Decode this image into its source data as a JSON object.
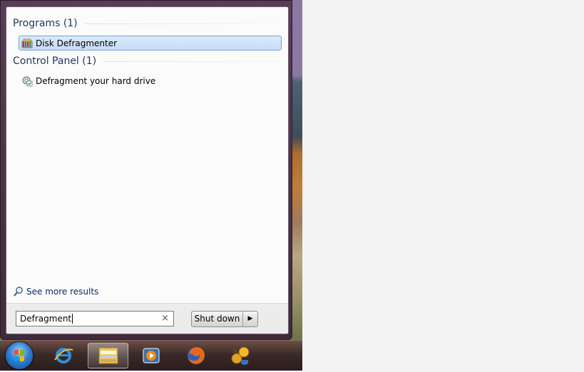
{
  "start_menu": {
    "groups": [
      {
        "title": "Programs (1)",
        "items": [
          {
            "label": "Disk Defragmenter",
            "icon": "disk-defragmenter-icon",
            "selected": true
          }
        ]
      },
      {
        "title": "Control Panel (1)",
        "items": [
          {
            "label": "Defragment your hard drive",
            "icon": "control-panel-item-icon",
            "selected": false
          }
        ]
      }
    ],
    "see_more": "See more results",
    "search": {
      "value": "Defragment",
      "clear_glyph": "×"
    },
    "shutdown": {
      "label": "Shut down",
      "arrow_glyph": "▶"
    }
  },
  "taskbar": {
    "items": [
      {
        "name": "start-button"
      },
      {
        "name": "internet-explorer"
      },
      {
        "name": "windows-explorer",
        "active": true
      },
      {
        "name": "media-player"
      },
      {
        "name": "firefox"
      },
      {
        "name": "security-tool"
      }
    ]
  },
  "colors": {
    "group_header": "#1e395b",
    "selected_bg": "#c4dcf7",
    "selected_border": "#7da2ce",
    "link": "#0d2a6b"
  }
}
